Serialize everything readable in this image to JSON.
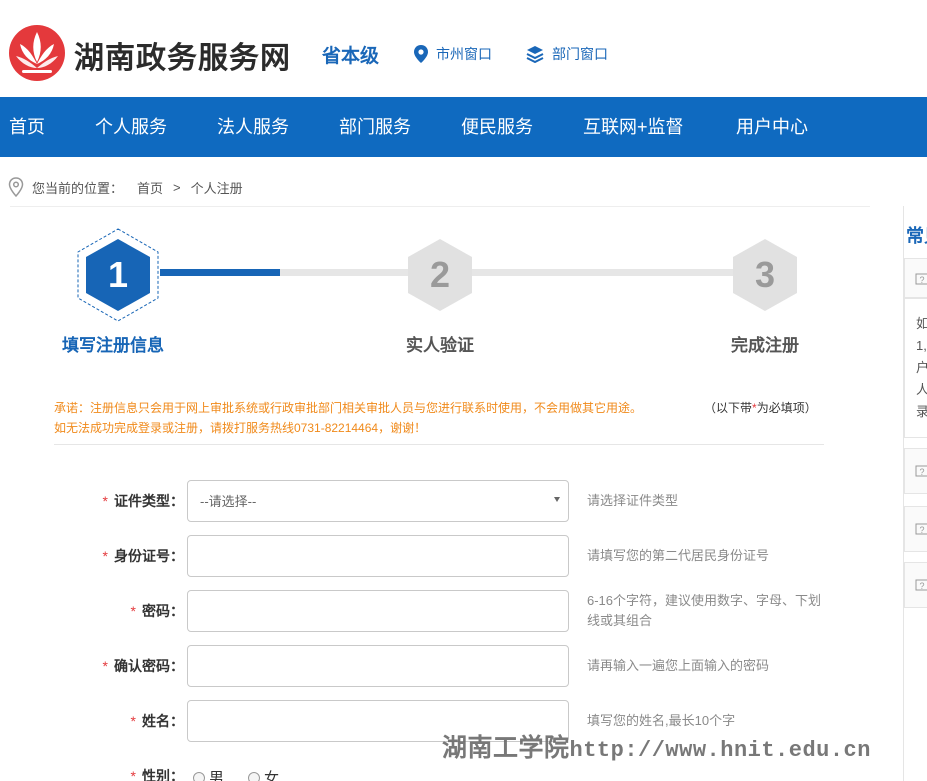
{
  "header": {
    "site_title": "湖南政务服务网",
    "level": "省本级",
    "links": [
      "市州窗口",
      "部门窗口"
    ],
    "brand_color": "#1a67b8",
    "logo_color": "#e4393c"
  },
  "nav": {
    "items": [
      "首页",
      "个人服务",
      "法人服务",
      "部门服务",
      "便民服务",
      "互联网+监督",
      "用户中心"
    ],
    "background": "#0f6ac0"
  },
  "breadcrumb": {
    "prefix": "您当前的位置：",
    "items": [
      "首页",
      "个人注册"
    ],
    "separator": ">"
  },
  "steps": [
    {
      "number": "1",
      "label": "填写注册信息",
      "active": true
    },
    {
      "number": "2",
      "label": "实人验证",
      "active": false
    },
    {
      "number": "3",
      "label": "完成注册",
      "active": false
    }
  ],
  "notice": {
    "line1": "承诺：注册信息只会用于网上审批系统或行政审批部门相关审批人员与您进行联系时使用，不会用做其它用途。",
    "line2": "如无法成功完成登录或注册，请拨打服务热线0731-82214464，谢谢！",
    "required_prefix": "（以下带",
    "required_star": "*",
    "required_suffix": "为必填项）"
  },
  "form": {
    "id_type": {
      "label": "证件类型：",
      "value": "--请选择--",
      "hint": "请选择证件类型"
    },
    "id_number": {
      "label": "身份证号：",
      "value": "",
      "hint": "请填写您的第二代居民身份证号"
    },
    "password": {
      "label": "密码：",
      "value": "",
      "hint": "6-16个字符，建议使用数字、字母、下划线或其组合"
    },
    "confirm_password": {
      "label": "确认密码：",
      "value": "",
      "hint": "请再输入一遍您上面输入的密码"
    },
    "name": {
      "label": "姓名：",
      "value": "",
      "hint": "填写您的姓名,最长10个字"
    },
    "gender": {
      "label": "性别：",
      "options": [
        "男",
        "女"
      ]
    },
    "required_star": "*"
  },
  "sidebar": {
    "title": "常见",
    "text_lines": [
      "如",
      "1,",
      "户",
      "人",
      "录"
    ]
  },
  "watermark": {
    "text": "湖南工学院",
    "url": "http://www.hnit.edu.cn"
  }
}
